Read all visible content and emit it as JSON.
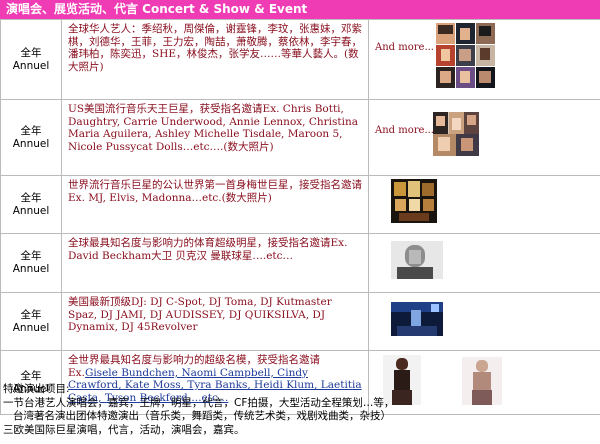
{
  "header": {
    "title": "演唱会、展览活动、代言 Concert & Show & Event"
  },
  "more_label": "And more...",
  "rows": [
    {
      "term": [
        "全年",
        "Annuel"
      ],
      "desc": "全球华人艺人：季绍秋，周傑倫，谢霆锋，李玟，张惠妹，邓紫棋，刘德华，王菲，王力宏，陶喆，萧敬腾，蔡依林，李宇春，潘玮柏，陈奕迅，SHE，林俊杰，张学友……等華人藝人。(数大照片)"
    },
    {
      "term": [
        "全年",
        "Annuel"
      ],
      "desc": "US美国流行音乐天王巨星，获受指名邀请Ex. Chris Botti, Daughtry, Carrie Underwood, Annie Lennox, Christina Maria Aguilera, Ashley Michelle Tisdale, Maroon 5, Nicole Pussycat Dolls…etc….(数大照片)"
    },
    {
      "term": [
        "全年",
        "Annuel"
      ],
      "desc": "世界流行音乐巨星的公认世界第一首身梅世巨星，接受指名邀请Ex. MJ, Elvis, Madonna…etc.(数大照片)"
    },
    {
      "term": [
        "全年",
        "Annuel"
      ],
      "desc": "全球最具知名度与影响力的体育超级明星，接受指名邀请Ex. David Beckham大卫 贝克汉 曼联球星….etc…"
    },
    {
      "term": [
        "全年",
        "Annuel"
      ],
      "desc": "美国最新顶级DJ: DJ C-Spot, DJ Toma, DJ Kutmaster Spaz, DJ JAMI, DJ AUDISSEY, DJ QUIKSILVA, DJ Dynamix, DJ 45Revolver"
    },
    {
      "term": [
        "全年",
        "Annuel"
      ],
      "desc_pre": "全世界最具知名度与影响力的超级名模，获受指名邀请Ex.",
      "desc_links": "Gisele Bundchen, Naomi Campbell, Cindy Crawford, Kate Moss, Tyra Banks, Heidi Klum, Laetitia Casta, Tyson Beckford….etc…"
    }
  ],
  "notes": {
    "heading": "特邀演出项目:",
    "lines": [
      "一节台港艺人演唱会，嘉宾，王牌，明星，代言，CF拍摄，大型活动全程策划…等，",
      "   台湾著名演出团体特邀演出（音乐类，舞蹈类，传统艺术类，戏剧戏曲类，杂技）",
      "三欧美国际巨星演唱，代言，活动，演唱会，嘉宾。"
    ]
  },
  "colors": {
    "header_bg": "#f03cb4",
    "desc_text": "#8a1020",
    "link_text": "#1e3a9a"
  }
}
